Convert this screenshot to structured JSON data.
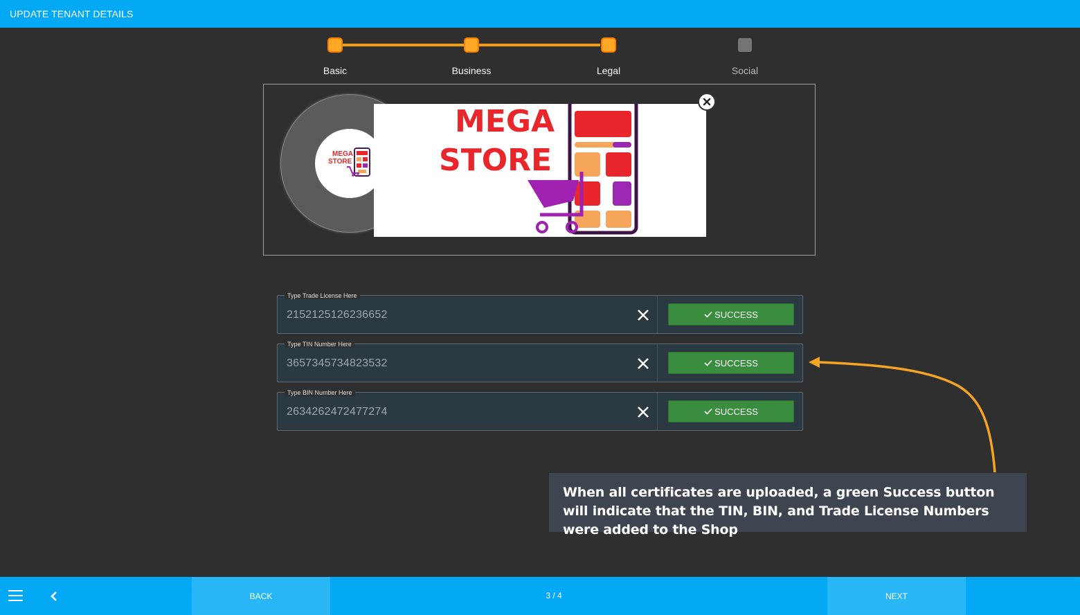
{
  "header": {
    "title": "UPDATE TENANT DETAILS"
  },
  "stepper": {
    "accent_color": "#f59e0b",
    "steps": [
      {
        "label": "Basic",
        "state": "done"
      },
      {
        "label": "Business",
        "state": "done"
      },
      {
        "label": "Legal",
        "state": "done"
      },
      {
        "label": "Social",
        "state": "todo"
      }
    ]
  },
  "image_panel": {
    "logo_text_line1": "MEGA",
    "logo_text_line2": "STORE"
  },
  "fields": [
    {
      "placeholder": "Type Trade License Here",
      "value": "2152125126236652",
      "status": "SUCCESS"
    },
    {
      "placeholder": "Type TIN Number Here",
      "value": "3657345734823532",
      "status": "SUCCESS"
    },
    {
      "placeholder": "Type BIN Number Here",
      "value": "2634262472477274",
      "status": "SUCCESS"
    }
  ],
  "callout": {
    "text": "When all certificates are uploaded, a green Success button will indicate that the TIN, BIN, and Trade License Numbers were added to the Shop",
    "arrow_color": "#f5a524"
  },
  "footer": {
    "back_label": "BACK",
    "next_label": "NEXT",
    "page_indicator": "3 / 4"
  },
  "colors": {
    "primary": "#03a9f4",
    "success": "#3a8d3e",
    "background": "#2f2f2f"
  }
}
